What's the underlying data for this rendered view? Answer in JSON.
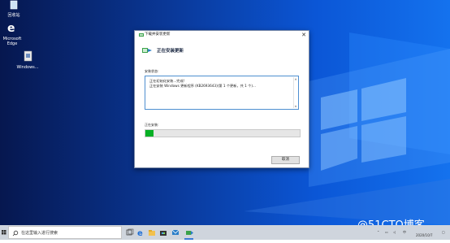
{
  "desktop": {
    "icons": [
      {
        "label": "回收站",
        "icon": "recycle-bin-icon"
      },
      {
        "label": "Microsoft Edge",
        "icon": "edge-icon"
      },
      {
        "label": "Windows...",
        "icon": "setup-file-icon"
      }
    ]
  },
  "dialog": {
    "title": "下载并安装更新",
    "header": "正在安装更新",
    "status_label": "安装状态:",
    "status_lines": [
      "正在初始化安装...完成!",
      "正在安装 Windows 更新程序 (KB2693643)(第 1 个更新，共 1 个)..."
    ],
    "progress_label": "正在安装:",
    "progress_fraction": 0.05,
    "cancel_label": "取消"
  },
  "taskbar": {
    "search_placeholder": "在这里输入进行搜索",
    "pinned": [
      "task-view-icon",
      "edge-icon",
      "file-explorer-icon",
      "store-icon",
      "mail-icon",
      "windows-update-installer-icon"
    ],
    "tray_time": "",
    "tray_date": "2020/10/7"
  },
  "watermark": "@51CTO博客",
  "colors": {
    "progress": "#07b025",
    "desktop_dark": "#06174f",
    "desktop_light": "#1472ee"
  }
}
